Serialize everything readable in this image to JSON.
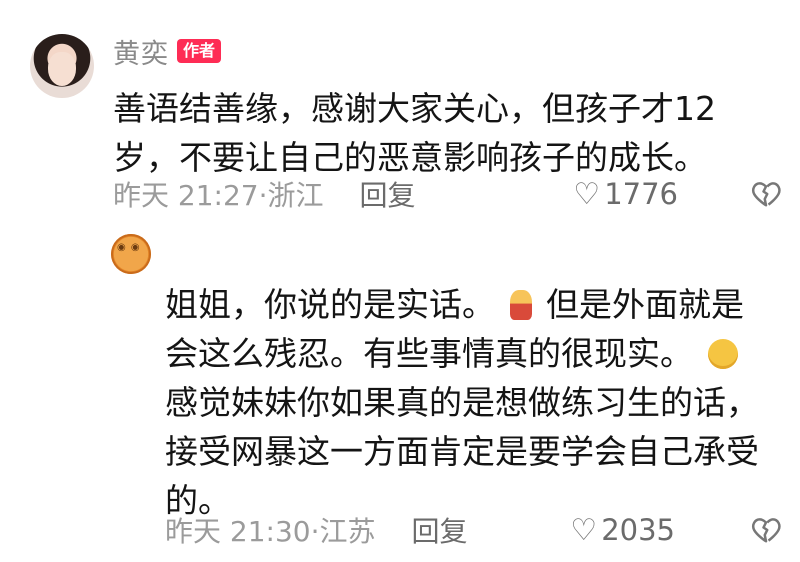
{
  "comments": [
    {
      "author": "黄奕",
      "badge": "作者",
      "text": "善语结善缘，感谢大家关心，但孩子才12岁，不要让自己的恶意影响孩子的成长。",
      "meta": "昨天 21:27·浙江",
      "reply_label": "回复",
      "likes": "1776"
    },
    {
      "text_parts": [
        "姐姐，你说的是实话。",
        "但是外面就是会这么残忍。有些事情真的很现实。",
        "感觉妹妹你如果真的是想做练习生的话，接受网暴这一方面肯定是要学会自己承受的。"
      ],
      "meta": "昨天 21:30·江苏",
      "reply_label": "回复",
      "likes": "2035"
    }
  ],
  "icons": [
    "heart-outline-icon",
    "broken-heart-icon",
    "person-emoji-icon",
    "pleading-face-emoji-icon"
  ],
  "colors": {
    "badge": "#fe2c55",
    "muted": "#9b9b9b"
  }
}
